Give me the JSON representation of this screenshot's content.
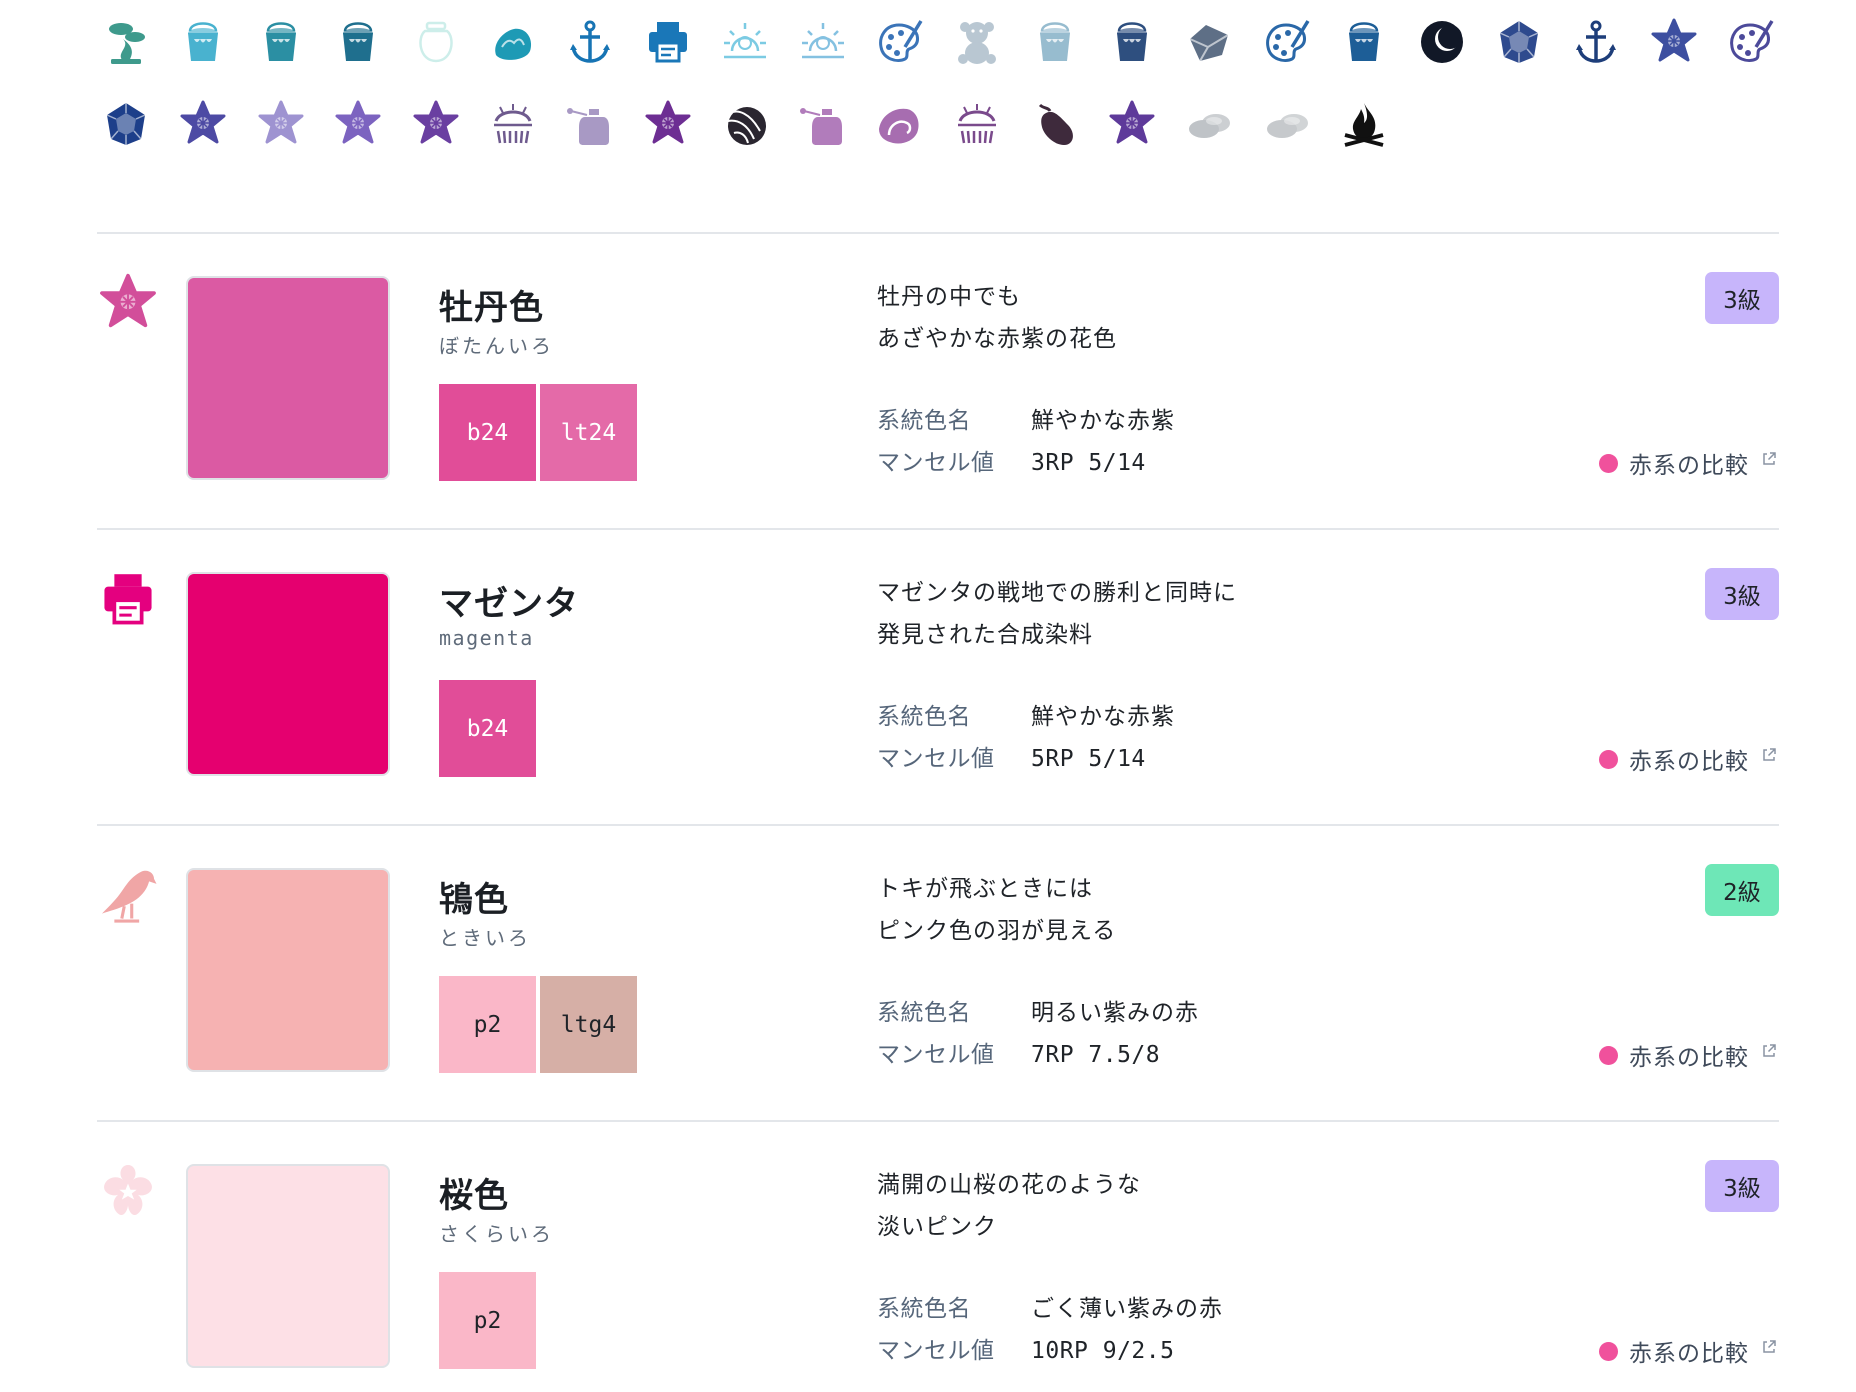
{
  "icon_grid": {
    "rows": [
      [
        {
          "name": "bonsai-icon",
          "color": "#3e9a8c"
        },
        {
          "name": "paint-bucket-icon",
          "color": "#49b2cf"
        },
        {
          "name": "paint-bucket-icon",
          "color": "#2b8fa3"
        },
        {
          "name": "paint-bucket-icon",
          "color": "#1f6f8e"
        },
        {
          "name": "jar-icon",
          "color": "#cdeeea"
        },
        {
          "name": "seaweed-icon",
          "color": "#1e9ab5"
        },
        {
          "name": "anchor-icon",
          "color": "#1774b4"
        },
        {
          "name": "printer-icon",
          "color": "#1a77b8"
        },
        {
          "name": "sunrise-icon",
          "color": "#7ccbe3"
        },
        {
          "name": "sunrise-icon",
          "color": "#84c1e1"
        },
        {
          "name": "palette-icon",
          "color": "#3b74b8"
        },
        {
          "name": "teddy-bear-icon",
          "color": "#b9c7d2"
        },
        {
          "name": "paint-bucket-icon",
          "color": "#97bccf"
        },
        {
          "name": "paint-bucket-icon",
          "color": "#2e4f7f"
        },
        {
          "name": "stone-icon",
          "color": "#5e6f86"
        },
        {
          "name": "palette-icon",
          "color": "#2a68a8"
        },
        {
          "name": "paint-bucket-icon",
          "color": "#1d5e97"
        },
        {
          "name": "crescent-moon-icon",
          "color": "#111827"
        },
        {
          "name": "gemstone-icon",
          "color": "#2e4a8e"
        },
        {
          "name": "anchor-icon",
          "color": "#1e3e7a"
        },
        {
          "name": "bellflower-icon",
          "color": "#3d4fa0"
        },
        {
          "name": "palette-icon",
          "color": "#4c4a9a"
        }
      ],
      [
        {
          "name": "gemstone-icon",
          "color": "#1d3f8a"
        },
        {
          "name": "bellflower-icon",
          "color": "#4d4aa4"
        },
        {
          "name": "bellflower-icon",
          "color": "#9e93d1"
        },
        {
          "name": "bellflower-icon",
          "color": "#7c63c0"
        },
        {
          "name": "bellflower-icon",
          "color": "#6a3fa1"
        },
        {
          "name": "wisteria-icon",
          "color": "#6e5a8e"
        },
        {
          "name": "perfume-bottle-icon",
          "color": "#a899c4"
        },
        {
          "name": "bellflower-icon",
          "color": "#6d2e93"
        },
        {
          "name": "beetle-wing-icon",
          "color": "#2a2630"
        },
        {
          "name": "perfume-bottle-icon",
          "color": "#b17cbb"
        },
        {
          "name": "seashell-icon",
          "color": "#a76db0"
        },
        {
          "name": "wisteria-icon",
          "color": "#7a4a8c"
        },
        {
          "name": "eggplant-icon",
          "color": "#3e2a3c"
        },
        {
          "name": "bellflower-icon",
          "color": "#5e3a9a"
        },
        {
          "name": "pebbles-icon",
          "color": "#bfc3c7"
        },
        {
          "name": "pebbles-icon",
          "color": "#c6c9cc"
        },
        {
          "name": "campfire-icon",
          "color": "#111111"
        }
      ]
    ]
  },
  "entries": [
    {
      "icon": "bellflower-icon",
      "icon_color": "#d24e9a",
      "swatch_color": "#db5aa3",
      "name": "牡丹色",
      "reading": "ぼたんいろ",
      "reading_mono": false,
      "chips": [
        {
          "label": "b24",
          "bg": "#e14d98",
          "fg": "#ffffff"
        },
        {
          "label": "lt24",
          "bg": "#e46aa8",
          "fg": "#ffffff"
        }
      ],
      "description": [
        "牡丹の中でも",
        "あざやかな赤紫の花色"
      ],
      "systematic_label": "系統色名",
      "systematic_value": "鮮やかな赤紫",
      "munsell_label": "マンセル値",
      "munsell_value": "3RP 5/14",
      "badge": {
        "label": "3級",
        "bg": "#c7b5fb"
      },
      "compare": {
        "label": "赤系の比較",
        "dot": "#f0519c"
      }
    },
    {
      "icon": "printer-icon",
      "icon_color": "#e4007f",
      "swatch_color": "#e5006f",
      "name": "マゼンタ",
      "reading": "magenta",
      "reading_mono": true,
      "chips": [
        {
          "label": "b24",
          "bg": "#e14d98",
          "fg": "#ffffff"
        }
      ],
      "description": [
        "マゼンタの戦地での勝利と同時に",
        "発見された合成染料"
      ],
      "systematic_label": "系統色名",
      "systematic_value": "鮮やかな赤紫",
      "munsell_label": "マンセル値",
      "munsell_value": "5RP 5/14",
      "badge": {
        "label": "3級",
        "bg": "#c7b5fb"
      },
      "compare": {
        "label": "赤系の比較",
        "dot": "#f0519c"
      }
    },
    {
      "icon": "ibis-icon",
      "icon_color": "#f0a6a6",
      "swatch_color": "#f6b2b2",
      "name": "鴇色",
      "reading": "ときいろ",
      "reading_mono": false,
      "chips": [
        {
          "label": "p2",
          "bg": "#fab7c8",
          "fg": "#1f2328"
        },
        {
          "label": "ltg4",
          "bg": "#d6afa6",
          "fg": "#1f2328"
        }
      ],
      "description": [
        "トキが飛ぶときには",
        "ピンク色の羽が見える"
      ],
      "systematic_label": "系統色名",
      "systematic_value": "明るい紫みの赤",
      "munsell_label": "マンセル値",
      "munsell_value": "7RP 7.5/8",
      "badge": {
        "label": "2級",
        "bg": "#6ee7b7"
      },
      "compare": {
        "label": "赤系の比較",
        "dot": "#f0519c"
      }
    },
    {
      "icon": "cherry-blossom-icon",
      "icon_color": "#fbdde3",
      "swatch_color": "#fde0e6",
      "name": "桜色",
      "reading": "さくらいろ",
      "reading_mono": false,
      "chips": [
        {
          "label": "p2",
          "bg": "#fab7c8",
          "fg": "#1f2328"
        }
      ],
      "description": [
        "満開の山桜の花のような",
        "淡いピンク"
      ],
      "systematic_label": "系統色名",
      "systematic_value": "ごく薄い紫みの赤",
      "munsell_label": "マンセル値",
      "munsell_value": "10RP 9/2.5",
      "badge": {
        "label": "3級",
        "bg": "#c7b5fb"
      },
      "compare": {
        "label": "赤系の比較",
        "dot": "#f0519c"
      }
    }
  ]
}
